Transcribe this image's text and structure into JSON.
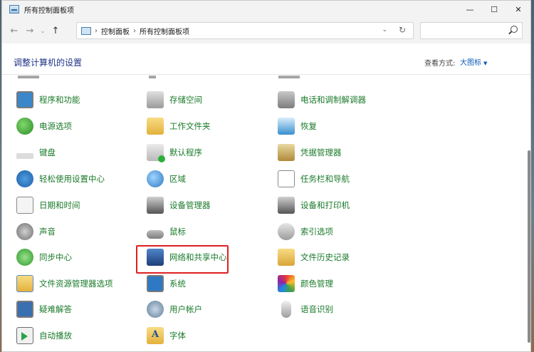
{
  "window": {
    "title": "所有控制面板项",
    "controls": {
      "minimize": "—",
      "maximize": "☐",
      "close": "✕"
    }
  },
  "navigation": {
    "back": "←",
    "forward": "→",
    "recent": "⌄",
    "up": "↑",
    "breadcrumb": [
      "控制面板",
      "所有控制面板项"
    ],
    "separator": "›",
    "dropdown": "⌄",
    "refresh": "↻",
    "search_placeholder": ""
  },
  "header": {
    "title": "调整计算机的设置",
    "view_by_label": "查看方式:",
    "view_by_value": "大图标"
  },
  "columns": [
    {
      "items": [
        {
          "label": "程序和功能",
          "icon": "programs-icon"
        },
        {
          "label": "电源选项",
          "icon": "power-icon"
        },
        {
          "label": "键盘",
          "icon": "keyboard-icon"
        },
        {
          "label": "轻松使用设置中心",
          "icon": "ease-of-access-icon"
        },
        {
          "label": "日期和时间",
          "icon": "clock-icon"
        },
        {
          "label": "声音",
          "icon": "speaker-icon"
        },
        {
          "label": "同步中心",
          "icon": "sync-icon"
        },
        {
          "label": "文件资源管理器选项",
          "icon": "folder-options-icon"
        },
        {
          "label": "疑难解答",
          "icon": "troubleshoot-icon"
        },
        {
          "label": "自动播放",
          "icon": "autoplay-icon"
        }
      ]
    },
    {
      "items": [
        {
          "label": "存储空间",
          "icon": "storage-icon"
        },
        {
          "label": "工作文件夹",
          "icon": "work-folders-icon"
        },
        {
          "label": "默认程序",
          "icon": "default-programs-icon"
        },
        {
          "label": "区域",
          "icon": "region-icon"
        },
        {
          "label": "设备管理器",
          "icon": "device-manager-icon"
        },
        {
          "label": "鼠标",
          "icon": "mouse-icon"
        },
        {
          "label": "网络和共享中心",
          "icon": "network-icon"
        },
        {
          "label": "系统",
          "icon": "system-icon"
        },
        {
          "label": "用户帐户",
          "icon": "users-icon"
        },
        {
          "label": "字体",
          "icon": "fonts-icon"
        }
      ]
    },
    {
      "items": [
        {
          "label": "电话和调制解调器",
          "icon": "phone-icon"
        },
        {
          "label": "恢复",
          "icon": "recovery-icon"
        },
        {
          "label": "凭据管理器",
          "icon": "credential-icon"
        },
        {
          "label": "任务栏和导航",
          "icon": "taskbar-icon"
        },
        {
          "label": "设备和打印机",
          "icon": "printer-icon"
        },
        {
          "label": "索引选项",
          "icon": "indexing-icon"
        },
        {
          "label": "文件历史记录",
          "icon": "file-history-icon"
        },
        {
          "label": "颜色管理",
          "icon": "color-icon"
        },
        {
          "label": "语音识别",
          "icon": "microphone-icon"
        }
      ]
    }
  ],
  "highlighted_item": "字体",
  "colors": {
    "link": "#1a7a2a",
    "title": "#1e3287",
    "highlight": "#e02020"
  }
}
